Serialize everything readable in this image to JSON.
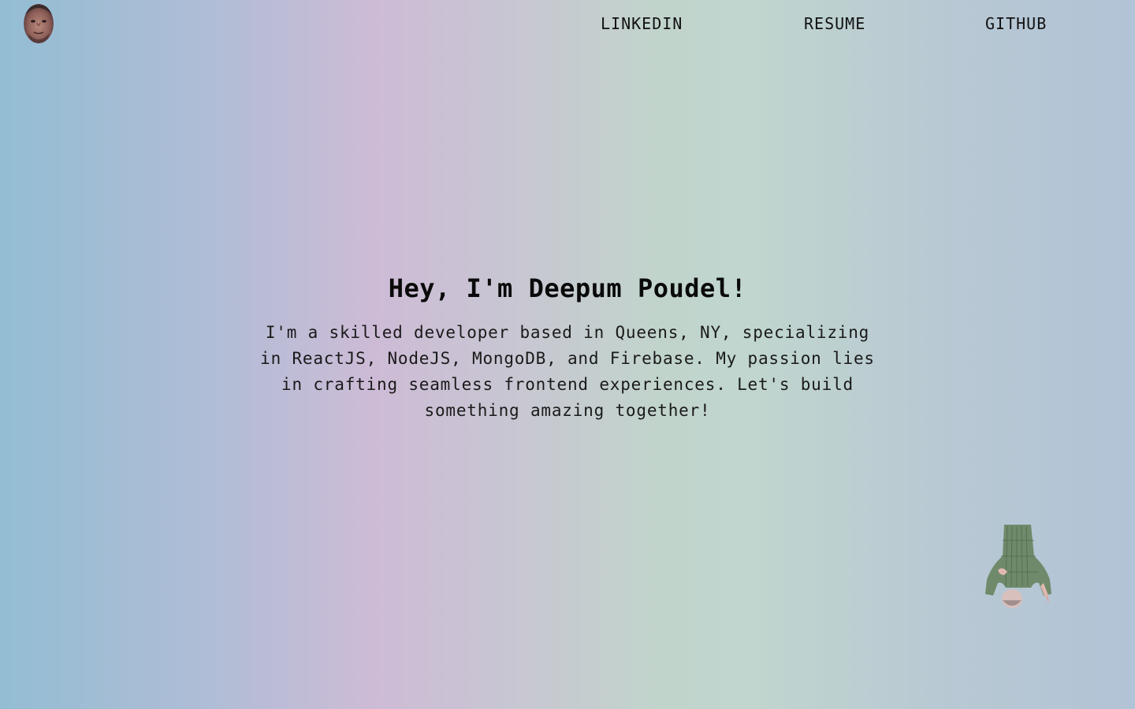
{
  "nav": {
    "logo_icon": "profile-photo-avatar-icon",
    "links": [
      {
        "label": "LINKEDIN"
      },
      {
        "label": "RESUME"
      },
      {
        "label": "GITHUB"
      }
    ]
  },
  "hero": {
    "title": "Hey, I'm Deepum Poudel!",
    "bio": "I'm a skilled developer based in Queens, NY, specializing in ReactJS, NodeJS, MongoDB, and Firebase. My passion lies in crafting seamless frontend experiences. Let's build something amazing together!"
  },
  "decor": {
    "figure_icon": "upside-down-person-pointing-icon"
  },
  "colors": {
    "background_left": "#93bdd3",
    "background_pink": "#cdbbd6",
    "background_mint": "#c0d6ce",
    "background_right": "#b1c3d6",
    "text": "#0d0d0d"
  }
}
